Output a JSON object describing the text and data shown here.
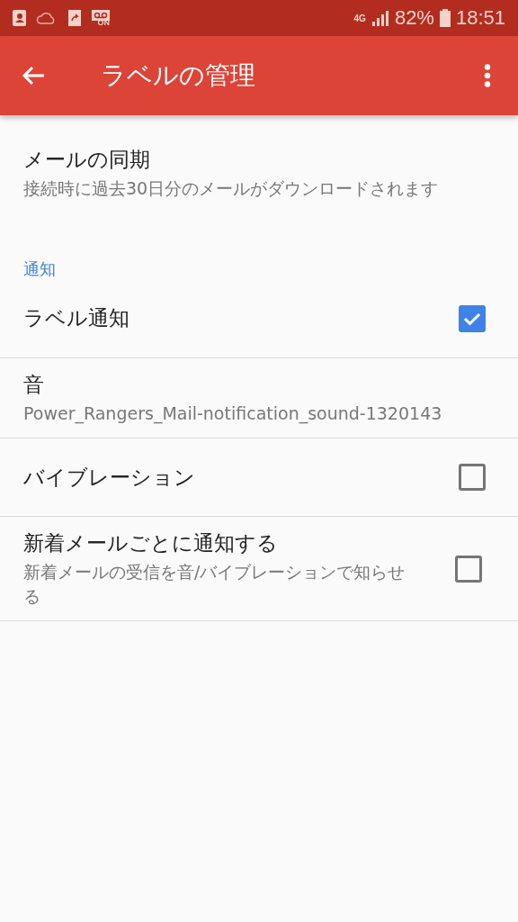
{
  "status_bar": {
    "voicemail_badge": "ON",
    "network": "4G",
    "battery": "82%",
    "time": "18:51"
  },
  "toolbar": {
    "title": "ラベルの管理"
  },
  "settings": [
    {
      "kind": "text",
      "title": "メールの同期",
      "summary": "接続時に過去30日分のメールがダウンロードされます",
      "divider": false
    },
    {
      "kind": "header",
      "title": "通知"
    },
    {
      "kind": "checkbox",
      "title": "ラベル通知",
      "checked": true,
      "divider": true
    },
    {
      "kind": "text",
      "title": "音",
      "summary": "Power_Rangers_Mail-notification_sound-1320143",
      "divider": true
    },
    {
      "kind": "checkbox",
      "title": "バイブレーション",
      "checked": false,
      "divider": true
    },
    {
      "kind": "checkbox",
      "title": "新着メールごとに通知する",
      "summary": "新着メールの受信を音/バイブレーションで知らせる",
      "checked": false,
      "divider": true
    }
  ]
}
